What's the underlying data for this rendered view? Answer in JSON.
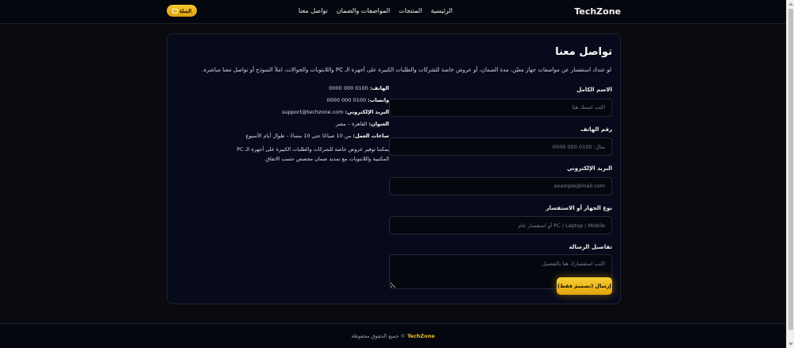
{
  "header": {
    "logo": "TechZone",
    "nav": [
      "الرئيسية",
      "المنتجات",
      "المواصفات والضمان",
      "تواصل معنا"
    ],
    "cart_label": "السلة"
  },
  "contact": {
    "title": "تواصل معنا",
    "intro": "لو عندك استفسار عن مواصفات جهاز معيّن، مدة الضمان، أو عروض خاصة للشركات والطلبات الكبيرة على أجهزة الـ PC واللابتوبات والجوالات، املأ النموذج أو تواصل معنا مباشرة."
  },
  "form": {
    "name_label": "الاسم الكامل",
    "name_placeholder": "اكتب اسمك هنا",
    "phone_label": "رقم الهاتف",
    "phone_placeholder": "مثال: 0100 000 0000",
    "email_label": "البريد الإلكتروني",
    "email_placeholder": "example@mail.com",
    "device_label": "نوع الجهاز أو الاستفسار",
    "device_placeholder": "PC / Laptop / Mobile أو استفسار عام",
    "message_label": "تفاصيل الرسالة",
    "message_placeholder": "اكتب استفسارك هنا بالتفصيل",
    "submit_label": "إرسال (تصميم فقط)"
  },
  "info": {
    "phone_key": "الهاتف:",
    "phone_value": "0100 000 0000",
    "whatsapp_key": "واتساب:",
    "whatsapp_value": "0100 000 0000",
    "email_key": "البريد الإلكتروني:",
    "email_value": "support@techzone.com",
    "address_key": "العنوان:",
    "address_value": "القاهرة – مصر",
    "hours_key": "ساعات العمل:",
    "hours_value": "من 10 صباحًا حتى 10 مساءً – طوال أيام الأسبوع",
    "note": "يمكننا توفير عروض خاصة للشركات والطلبات الكبيرة على أجهزة الـ PC المكتبية واللابتوبات مع تمديد ضمان مخصص حسب الاتفاق."
  },
  "footer": {
    "text": "جميع الحقوق محفوظة ©",
    "brand": "TechZone"
  },
  "colors": {
    "accent": "#f0c229",
    "background": "#0b0b0f",
    "card": "#070a1a"
  },
  "icons": {
    "cart": "cart-icon"
  }
}
